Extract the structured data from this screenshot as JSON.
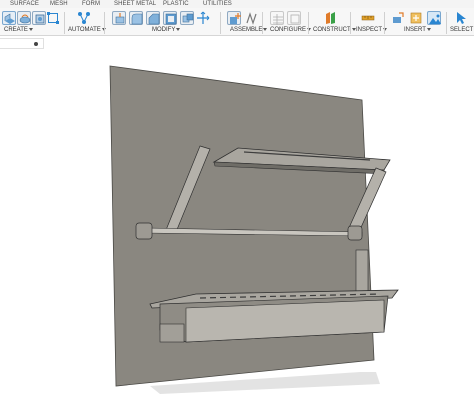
{
  "tabs": [
    "SURFACE",
    "MESH",
    "FORM",
    "SHEET METAL",
    "PLASTIC",
    "UTILITIES"
  ],
  "groups": {
    "create": "CREATE",
    "automate": "AUTOMATE",
    "modify": "MODIFY",
    "assemble": "ASSEMBLE",
    "configure": "CONFIGURE",
    "construct": "CONSTRUCT",
    "inspect": "INSPECT",
    "insert": "INSERT",
    "select": "SELECT"
  },
  "icons": {
    "create": [
      "extrude-icon",
      "revolve-icon",
      "box-icon",
      "sketch-dimension-icon"
    ],
    "automate": [
      "automate-icon"
    ],
    "modify": [
      "press-pull-icon",
      "fillet-icon",
      "chamfer-icon",
      "shell-icon",
      "combine-icon",
      "move-icon"
    ],
    "assemble": [
      "new-component-icon",
      "joint-icon"
    ],
    "configure": [
      "configure-table-icon",
      "configure-rule-icon"
    ],
    "construct": [
      "offset-plane-icon"
    ],
    "inspect": [
      "measure-icon"
    ],
    "insert": [
      "insert-derive-icon",
      "insert-mesh-icon",
      "insert-image-icon"
    ],
    "select": [
      "select-arrow-icon"
    ]
  },
  "colors": {
    "panel": "#8a8780",
    "shelf": "#a29f98",
    "edge": "#3a3a3a",
    "accent_blue": "#2a86d1",
    "accent_orange": "#e07b2a",
    "accent_green": "#3aa047"
  }
}
